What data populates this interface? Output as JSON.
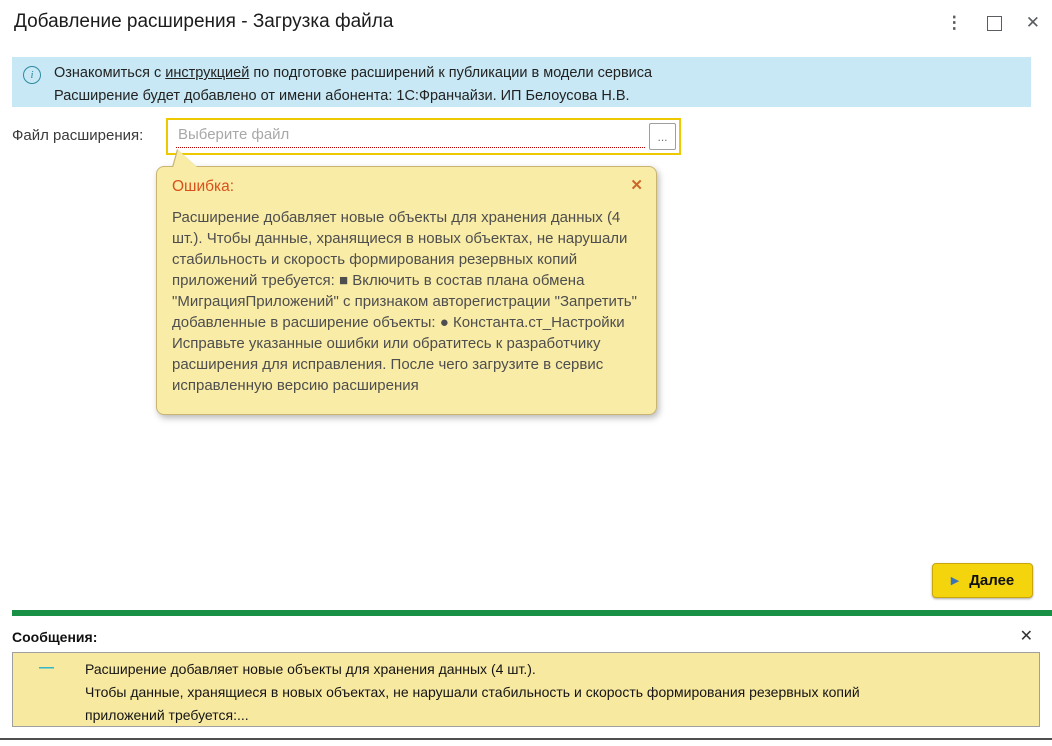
{
  "window": {
    "title": "Добавление расширения - Загрузка файла",
    "controls": {
      "menu_icon": "kebab-menu",
      "maximize_icon": "maximize-square",
      "close_icon": "close-x",
      "close_glyph": "✕",
      "menu_glyph": "⋮"
    }
  },
  "banner": {
    "icon": "info-circle-icon",
    "line1_pre": "Ознакомиться с ",
    "line1_link": "инструкцией",
    "line1_post": " по подготовке расширений к публикации в модели сервиса",
    "line2": "Расширение будет добавлено от имени абонента: 1С:Франчайзи. ИП Белоусова Н.В."
  },
  "file_row": {
    "label": "Файл расширения:",
    "placeholder": "Выберите файл",
    "value": "",
    "browse_label": "..."
  },
  "tooltip": {
    "title": "Ошибка:",
    "close_glyph": "✕",
    "body": "Расширение добавляет новые объекты для хранения данных (4 шт.). Чтобы данные, хранящиеся в новых объектах, не нарушали стабильность и скорость формирования резервных копий приложений требуется: ■ Включить в состав плана обмена \"МиграцияПриложений\" с признаком авторегистрации \"Запретить\" добавленные в расширение объекты: ● Константа.ст_Настройки Исправьте указанные ошибки или обратитесь к разработчику расширения для исправления. После чего загрузите в сервис исправленную версию расширения"
  },
  "actions": {
    "next_icon": "▶",
    "next_label": "Далее"
  },
  "messages": {
    "header": "Сообщения:",
    "close_glyph": "✕",
    "items": [
      {
        "marker": "—",
        "lines": [
          "Расширение добавляет новые объекты для хранения данных (4 шт.).",
          "Чтобы данные, хранящиеся в новых объектах, не нарушали стабильность и скорость формирования резервных копий",
          "приложений требуется:..."
        ]
      }
    ]
  },
  "colors": {
    "banner_bg": "#c7e8f4",
    "info_icon": "#2f8ba0",
    "field_highlight_border": "#eec900",
    "error_underline": "#b40000",
    "tooltip_bg": "#f9eca7",
    "tooltip_title": "#d8511c",
    "next_button_bg": "#f4d50d",
    "green_separator": "#189045",
    "message_box_bg": "#f8e9a1",
    "message_marker": "#2eb6c9"
  }
}
